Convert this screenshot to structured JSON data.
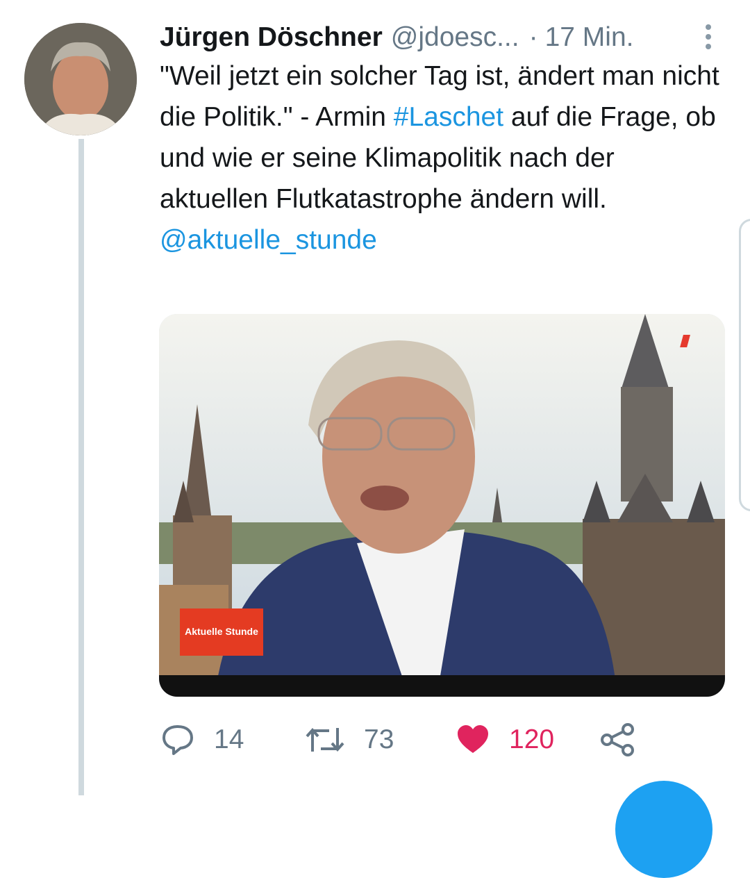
{
  "tweet": {
    "author_name": "Jürgen Döschner",
    "author_handle": "@jdoesc...",
    "separator": "·",
    "time": "17 Min.",
    "text_part1": "\"Weil jetzt ein solcher Tag ist, ändert man nicht die Politik.\" - Armin ",
    "hashtag": "#Laschet",
    "text_part2": " auf die Frage, ob und wie er seine Klimapolitik nach der aktuellen Flutkatastrophe ändern will.",
    "mention": "@aktuelle_stunde",
    "media": {
      "lower_third_label": "Aktuelle Stunde"
    }
  },
  "actions": {
    "reply_count": "14",
    "retweet_count": "73",
    "like_count": "120"
  },
  "icons": {
    "more": "more-vertical-icon",
    "reply": "reply-icon",
    "retweet": "retweet-icon",
    "like": "heart-icon",
    "share": "share-icon"
  },
  "colors": {
    "link": "#1b95e0",
    "like": "#e0245e",
    "muted": "#657786"
  }
}
